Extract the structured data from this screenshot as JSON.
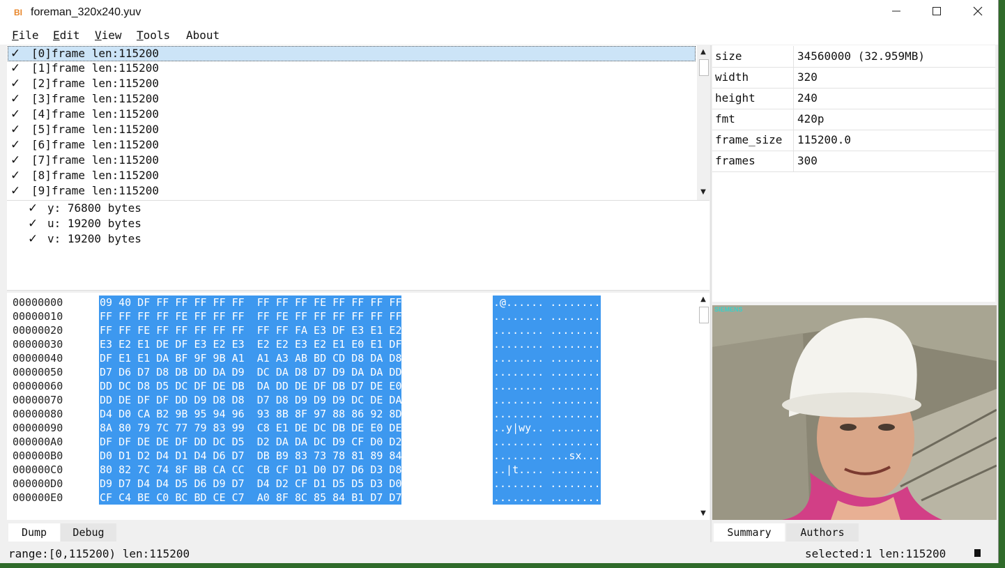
{
  "window": {
    "app_icon": "BI",
    "title": "foreman_320x240.yuv",
    "controls": [
      "minimize-icon",
      "maximize-icon",
      "close-icon"
    ]
  },
  "menu": [
    {
      "label": "File",
      "accel": "F",
      "rest": "ile"
    },
    {
      "label": "Edit",
      "accel": "E",
      "rest": "dit"
    },
    {
      "label": "View",
      "accel": "V",
      "rest": "iew"
    },
    {
      "label": "Tools",
      "accel": "T",
      "rest": "ools"
    },
    {
      "label": "About",
      "accel": "",
      "rest": "About"
    }
  ],
  "frames": [
    {
      "label": "[0]frame len:115200",
      "checked": true,
      "selected": true
    },
    {
      "label": "[1]frame len:115200",
      "checked": true
    },
    {
      "label": "[2]frame len:115200",
      "checked": true
    },
    {
      "label": "[3]frame len:115200",
      "checked": true
    },
    {
      "label": "[4]frame len:115200",
      "checked": true
    },
    {
      "label": "[5]frame len:115200",
      "checked": true
    },
    {
      "label": "[6]frame len:115200",
      "checked": true
    },
    {
      "label": "[7]frame len:115200",
      "checked": true
    },
    {
      "label": "[8]frame len:115200",
      "checked": true
    },
    {
      "label": "[9]frame len:115200",
      "checked": true
    }
  ],
  "planes": [
    {
      "label": "y: 76800 bytes",
      "checked": true
    },
    {
      "label": "u: 19200 bytes",
      "checked": true
    },
    {
      "label": "v: 19200 bytes",
      "checked": true
    }
  ],
  "check_glyph": "✓",
  "hex": [
    {
      "offset": "00000000",
      "bytes": "09 40 DF FF FF FF FF FF  FF FF FF FE FF FF FF FF",
      "ascii": ".@...... ........"
    },
    {
      "offset": "00000010",
      "bytes": "FF FF FF FF FE FF FF FF  FF FE FF FF FF FF FF FF",
      "ascii": "........ ........"
    },
    {
      "offset": "00000020",
      "bytes": "FF FF FE FF FF FF FF FF  FF FF FA E3 DF E3 E1 E2",
      "ascii": "........ ........"
    },
    {
      "offset": "00000030",
      "bytes": "E3 E2 E1 DE DF E3 E2 E3  E2 E2 E3 E2 E1 E0 E1 DF",
      "ascii": "........ ........"
    },
    {
      "offset": "00000040",
      "bytes": "DF E1 E1 DA BF 9F 9B A1  A1 A3 AB BD CD D8 DA D8",
      "ascii": "........ ........"
    },
    {
      "offset": "00000050",
      "bytes": "D7 D6 D7 D8 DB DD DA D9  DC DA D8 D7 D9 DA DA DD",
      "ascii": "........ ........"
    },
    {
      "offset": "00000060",
      "bytes": "DD DC D8 D5 DC DF DE DB  DA DD DE DF DB D7 DE E0",
      "ascii": "........ ........"
    },
    {
      "offset": "00000070",
      "bytes": "DD DE DF DF DD D9 D8 D8  D7 D8 D9 D9 D9 DC DE DA",
      "ascii": "........ ........"
    },
    {
      "offset": "00000080",
      "bytes": "D4 D0 CA B2 9B 95 94 96  93 8B 8F 97 88 86 92 8D",
      "ascii": "........ ........"
    },
    {
      "offset": "00000090",
      "bytes": "8A 80 79 7C 77 79 83 99  C8 E1 DE DC DB DE E0 DE",
      "ascii": "..y|wy.. ........"
    },
    {
      "offset": "000000A0",
      "bytes": "DF DF DE DE DF DD DC D5  D2 DA DA DC D9 CF D0 D2",
      "ascii": "........ ........"
    },
    {
      "offset": "000000B0",
      "bytes": "D0 D1 D2 D4 D1 D4 D6 D7  DB B9 83 73 78 81 89 84",
      "ascii": "........ ...sx..."
    },
    {
      "offset": "000000C0",
      "bytes": "80 82 7C 74 8F BB CA CC  CB CF D1 D0 D7 D6 D3 D8",
      "ascii": "..|t.... ........"
    },
    {
      "offset": "000000D0",
      "bytes": "D9 D7 D4 D4 D5 D6 D9 D7  D4 D2 CF D1 D5 D5 D3 D0",
      "ascii": "........ ........"
    },
    {
      "offset": "000000E0",
      "bytes": "CF C4 BE C0 BC BD CE C7  A0 8F 8C 85 84 B1 D7 D7",
      "ascii": "........ ........"
    }
  ],
  "left_tabs": [
    {
      "label": "Dump",
      "active": true
    },
    {
      "label": "Debug",
      "active": false
    }
  ],
  "properties": [
    {
      "key": "size",
      "value": "34560000 (32.959MB)"
    },
    {
      "key": "width",
      "value": "320"
    },
    {
      "key": "height",
      "value": "240"
    },
    {
      "key": "fmt",
      "value": "420p"
    },
    {
      "key": "frame_size",
      "value": "115200.0"
    },
    {
      "key": "frames",
      "value": "300"
    }
  ],
  "preview": {
    "watermark": "SIEMENS",
    "colors": {
      "wall": "#b9b5a4",
      "helmet": "#f4f3ee",
      "skin": "#d9a688",
      "shirt": "#d23f86",
      "background": "#8a8674"
    }
  },
  "right_tabs": [
    {
      "label": "Summary",
      "active": true
    },
    {
      "label": "Authors",
      "active": false
    }
  ],
  "status": {
    "left": "range:[0,115200) len:115200",
    "right": "selected:1 len:115200"
  },
  "scroll_icons": {
    "up": "▲",
    "down": "▼"
  }
}
